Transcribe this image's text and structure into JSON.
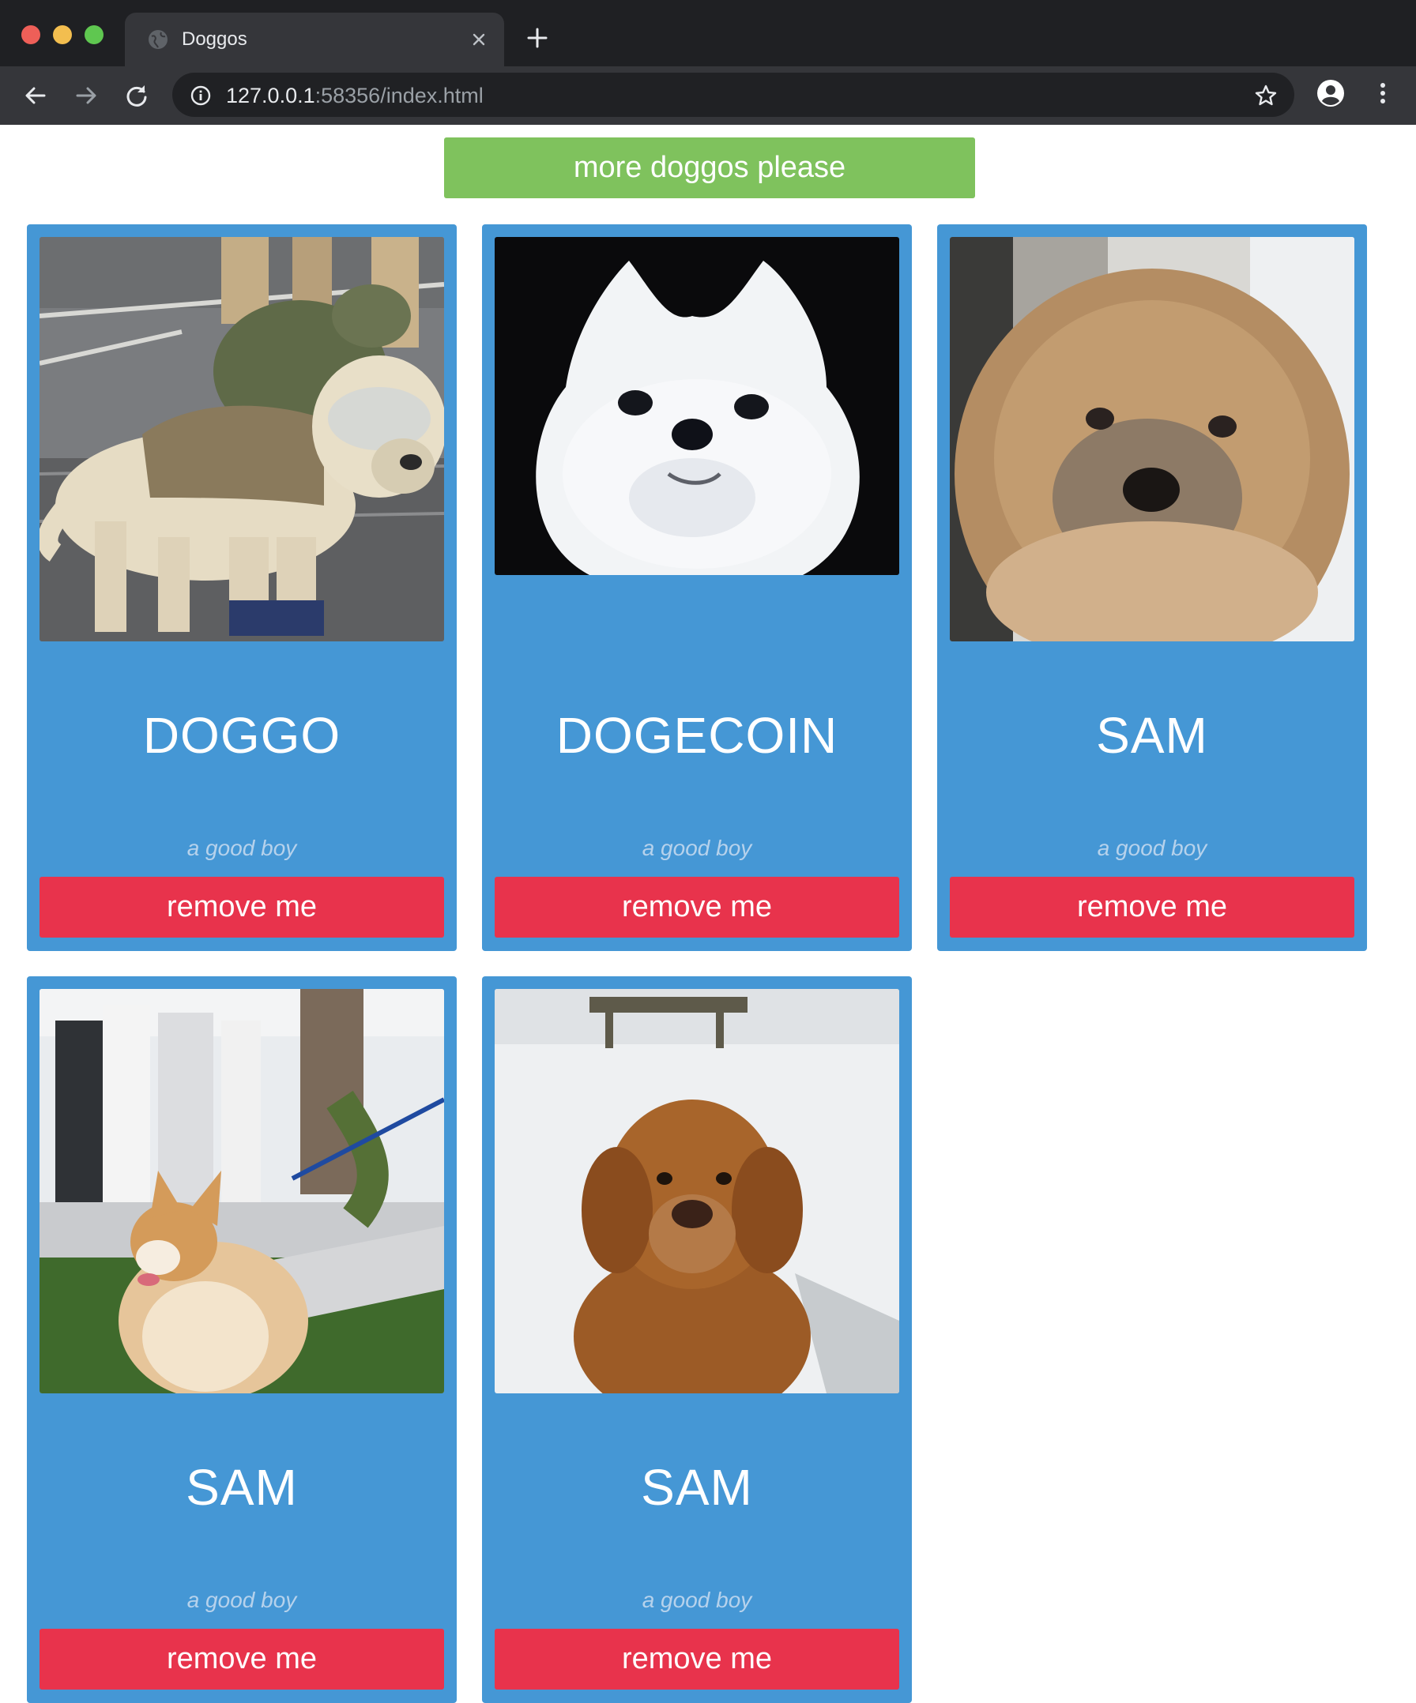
{
  "browser": {
    "tab_title": "Doggos",
    "url_host": "127.0.0.1",
    "url_rest": ":58356/index.html"
  },
  "page": {
    "more_button_label": "more doggos please",
    "colors": {
      "card_bg": "#4597d5",
      "more_button": "#7fc25d",
      "remove_button": "#e8334c"
    }
  },
  "cards": [
    {
      "name": "DOGGO",
      "description": "a good boy",
      "remove_label": "remove me",
      "photo": "rescue-labrador-photo"
    },
    {
      "name": "DOGECOIN",
      "description": "a good boy",
      "remove_label": "remove me",
      "photo": "white-spitz-photo"
    },
    {
      "name": "SAM",
      "description": "a good boy",
      "remove_label": "remove me",
      "photo": "chow-puppy-photo"
    },
    {
      "name": "SAM",
      "description": "a good boy",
      "remove_label": "remove me",
      "photo": "corgi-photo"
    },
    {
      "name": "SAM",
      "description": "a good boy",
      "remove_label": "remove me",
      "photo": "golden-retriever-snow-photo"
    }
  ]
}
